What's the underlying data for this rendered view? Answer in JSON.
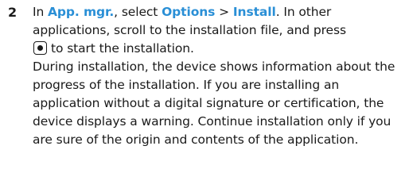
{
  "step": {
    "number": "2",
    "p1_in": "In ",
    "app_mgr": "App. mgr.",
    "p1_select": ", select ",
    "options": "Options",
    "sep": " > ",
    "install": "Install",
    "p1_rest": ". In other applications, scroll to the installation file, and press",
    "p1_end": "to start the installation.",
    "p2": "During installation, the device shows information about the progress of the installation. If you are installing an application without a digital signature or certification, the device displays a warning. Continue installation only if you are sure of the origin and contents of the application."
  },
  "icons": {
    "select_key": "select-key-icon"
  },
  "colors": {
    "ui_term": "#2a8fd6",
    "text": "#1a1a1a"
  }
}
